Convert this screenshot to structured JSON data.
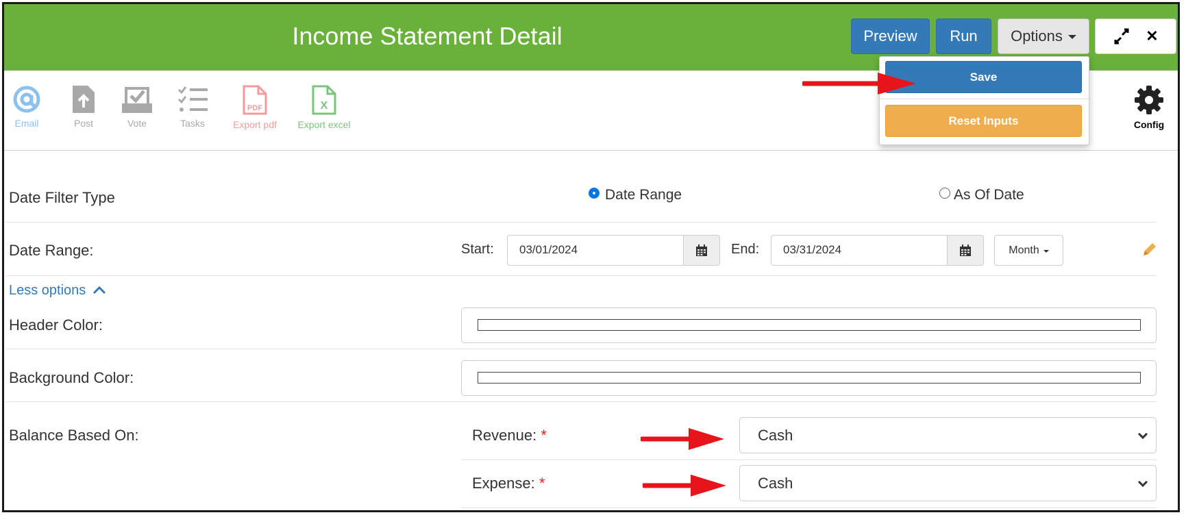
{
  "header": {
    "title": "Income Statement Detail",
    "preview_label": "Preview",
    "run_label": "Run",
    "options_label": "Options",
    "expand_icon": "expand-icon",
    "close_icon": "✕",
    "bg_color": "#69b13a"
  },
  "options_menu": {
    "save_label": "Save",
    "reset_label": "Reset Inputs"
  },
  "toolbar": {
    "email_label": "Email",
    "post_label": "Post",
    "vote_label": "Vote",
    "tasks_label": "Tasks",
    "export_pdf_label": "Export pdf",
    "export_excel_label": "Export excel",
    "config_label": "Config",
    "pdf_badge": "PDF",
    "excel_badge": "X"
  },
  "form": {
    "date_filter_type_label": "Date Filter Type",
    "date_range_option": "Date Range",
    "as_of_date_option": "As Of Date",
    "date_range_label": "Date Range:",
    "start_label": "Start:",
    "start_value": "03/01/2024",
    "end_label": "End:",
    "end_value": "03/31/2024",
    "period_label": "Month",
    "less_options_label": "Less options",
    "header_color_label": "Header Color:",
    "background_color_label": "Background Color:",
    "balance_based_on_label": "Balance Based On:",
    "revenue_label": "Revenue:",
    "revenue_value": "Cash",
    "expense_label": "Expense:",
    "expense_value": "Cash",
    "required_mark": "*"
  }
}
